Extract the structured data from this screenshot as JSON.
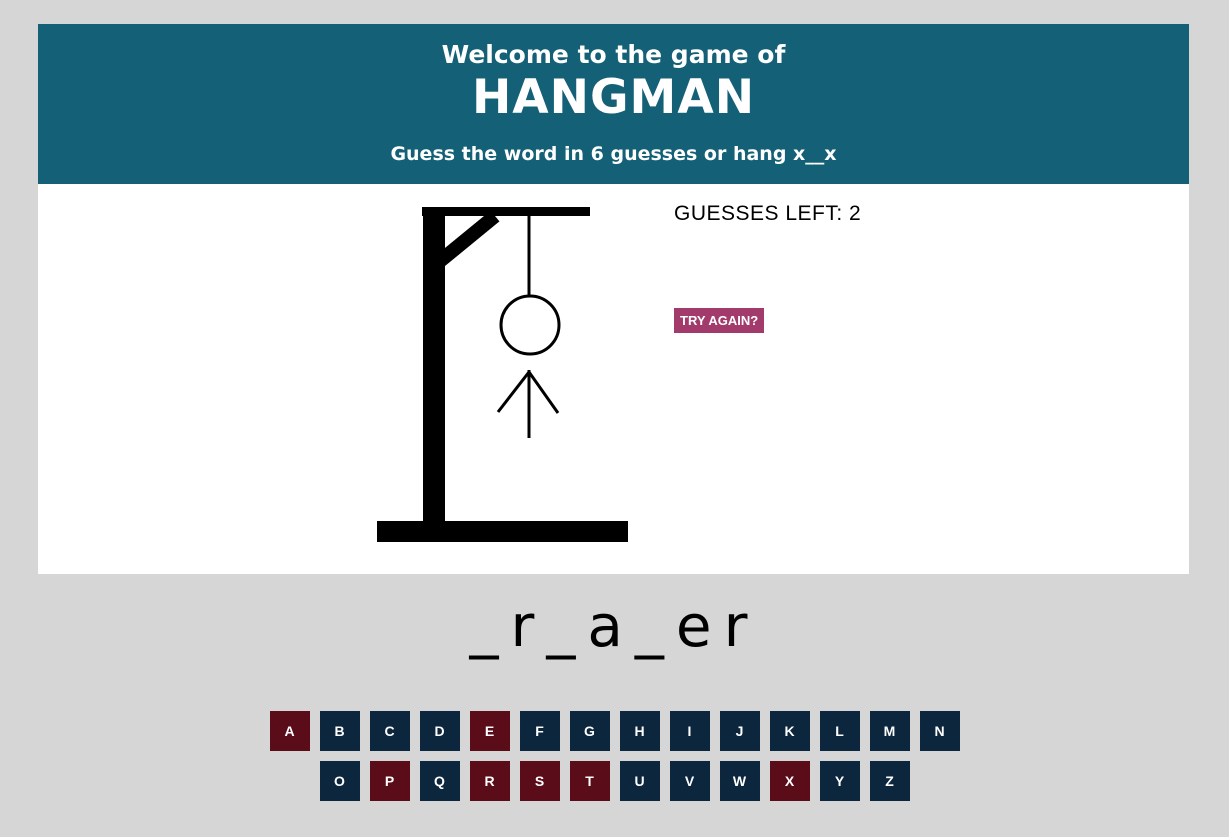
{
  "header": {
    "welcome": "Welcome to the game of",
    "title": "HANGMAN",
    "subtitle": "Guess the word in 6 guesses or hang x__x"
  },
  "status": {
    "guesses_left_label": "GUESSES LEFT: 2",
    "try_again_label": "TRY AGAIN?"
  },
  "word": {
    "display": "_r_a_er"
  },
  "hangman": {
    "parts_shown": [
      "head",
      "body",
      "left-leg",
      "right-leg"
    ]
  },
  "keyboard": {
    "row1": [
      {
        "letter": "A",
        "used": true
      },
      {
        "letter": "B",
        "used": false
      },
      {
        "letter": "C",
        "used": false
      },
      {
        "letter": "D",
        "used": false
      },
      {
        "letter": "E",
        "used": true
      },
      {
        "letter": "F",
        "used": false
      },
      {
        "letter": "G",
        "used": false
      },
      {
        "letter": "H",
        "used": false
      },
      {
        "letter": "I",
        "used": false
      },
      {
        "letter": "J",
        "used": false
      },
      {
        "letter": "K",
        "used": false
      },
      {
        "letter": "L",
        "used": false
      },
      {
        "letter": "M",
        "used": false
      },
      {
        "letter": "N",
        "used": false
      }
    ],
    "row2": [
      {
        "letter": "O",
        "used": false
      },
      {
        "letter": "P",
        "used": true
      },
      {
        "letter": "Q",
        "used": false
      },
      {
        "letter": "R",
        "used": true
      },
      {
        "letter": "S",
        "used": true
      },
      {
        "letter": "T",
        "used": true
      },
      {
        "letter": "U",
        "used": false
      },
      {
        "letter": "V",
        "used": false
      },
      {
        "letter": "W",
        "used": false
      },
      {
        "letter": "X",
        "used": true
      },
      {
        "letter": "Y",
        "used": false
      },
      {
        "letter": "Z",
        "used": false
      }
    ]
  },
  "colors": {
    "header_bg": "#146076",
    "key_unused": "#0c263d",
    "key_used": "#5a0d19",
    "try_again_bg": "#a33a6c"
  }
}
